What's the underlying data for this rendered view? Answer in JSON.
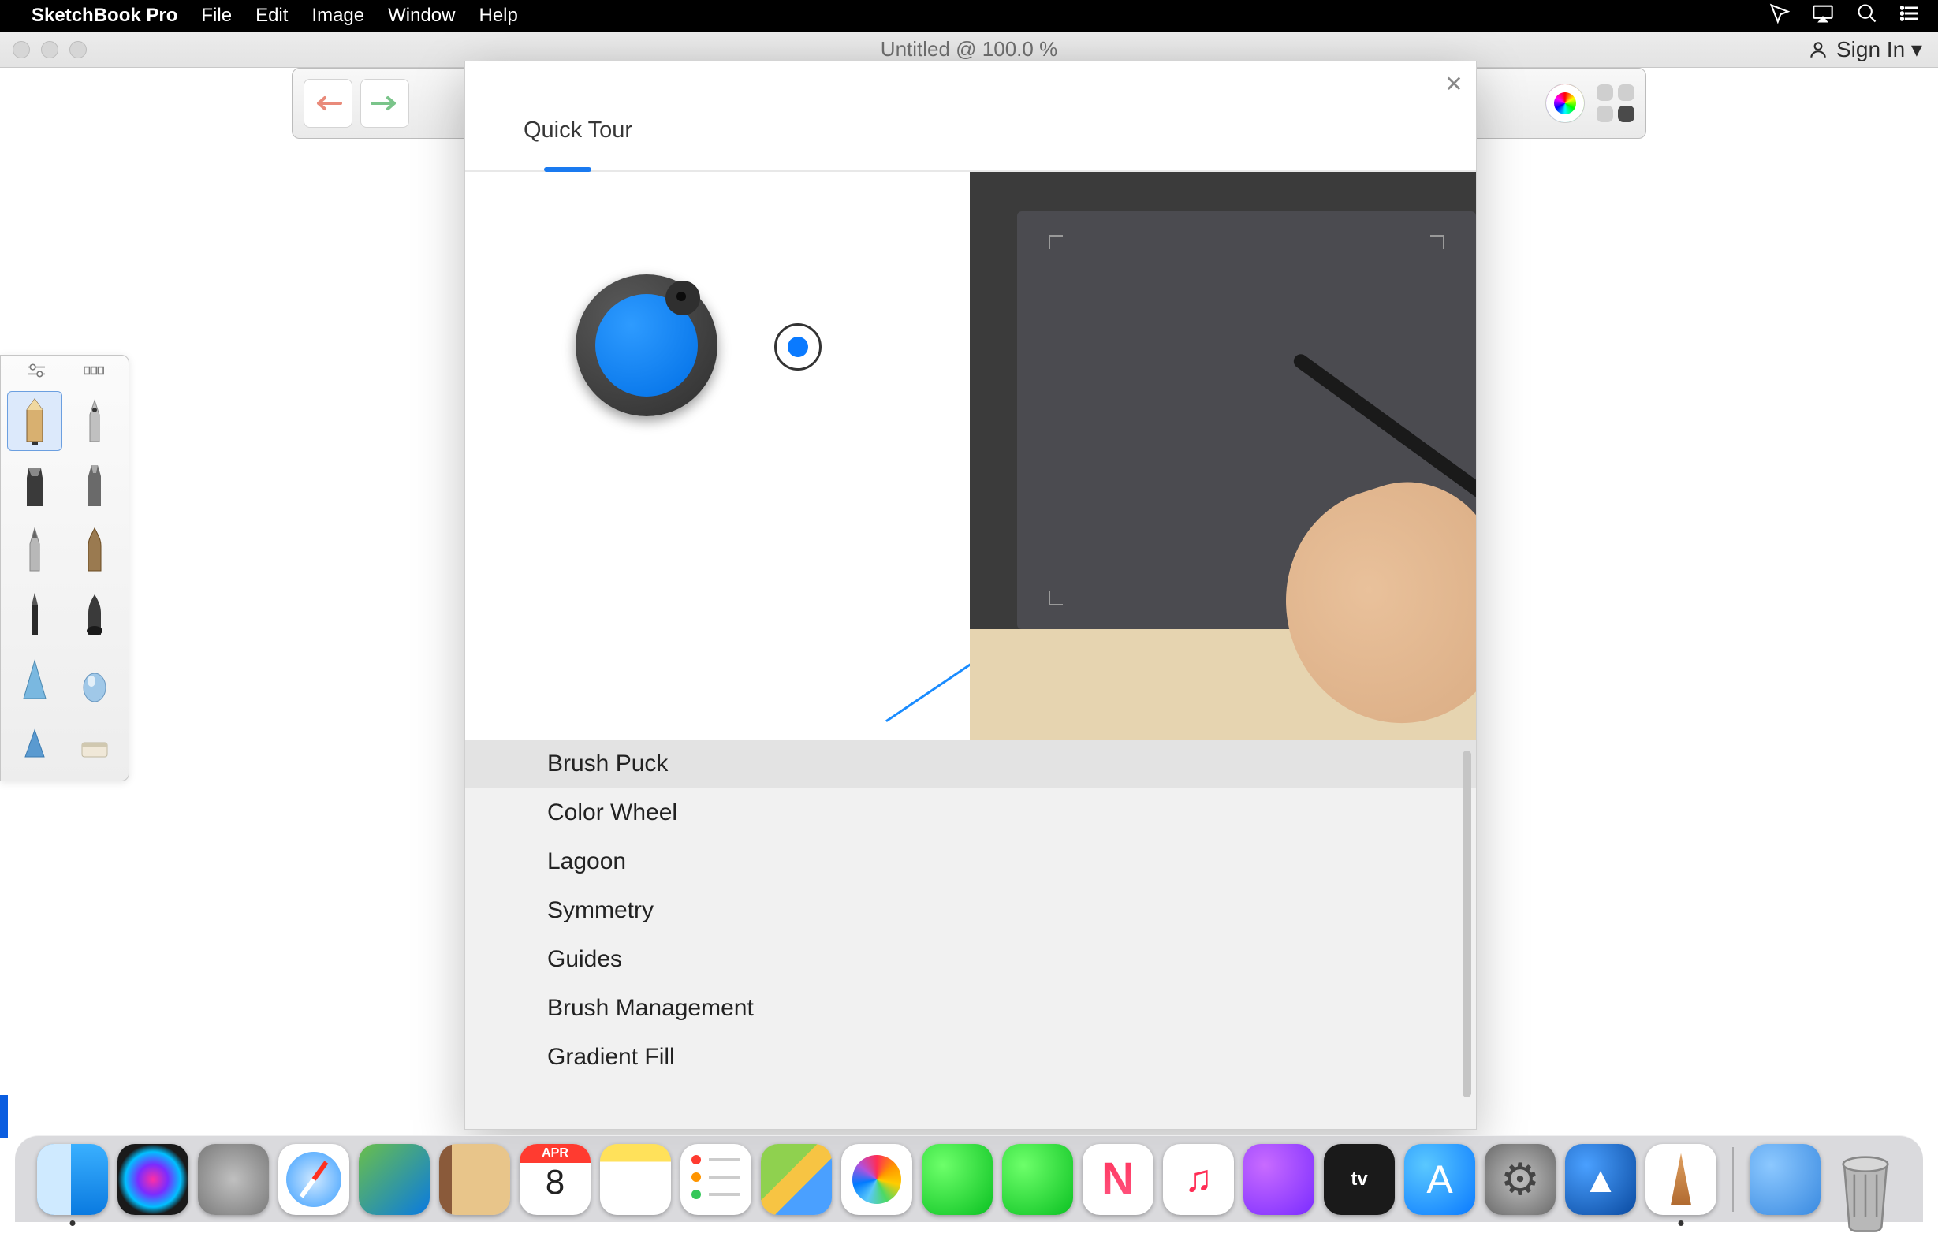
{
  "menubar": {
    "appname": "SketchBook Pro",
    "items": [
      "File",
      "Edit",
      "Image",
      "Window",
      "Help"
    ]
  },
  "window": {
    "title": "Untitled @ 100.0 %",
    "signin": "Sign In ▾"
  },
  "quicktour": {
    "title": "Quick Tour",
    "topics": [
      "Brush Puck",
      "Color Wheel",
      "Lagoon",
      "Symmetry",
      "Guides",
      "Brush Management",
      "Gradient Fill"
    ],
    "selected_index": 0
  },
  "calendar": {
    "month": "APR",
    "day": "8"
  },
  "tv_label": "tv"
}
